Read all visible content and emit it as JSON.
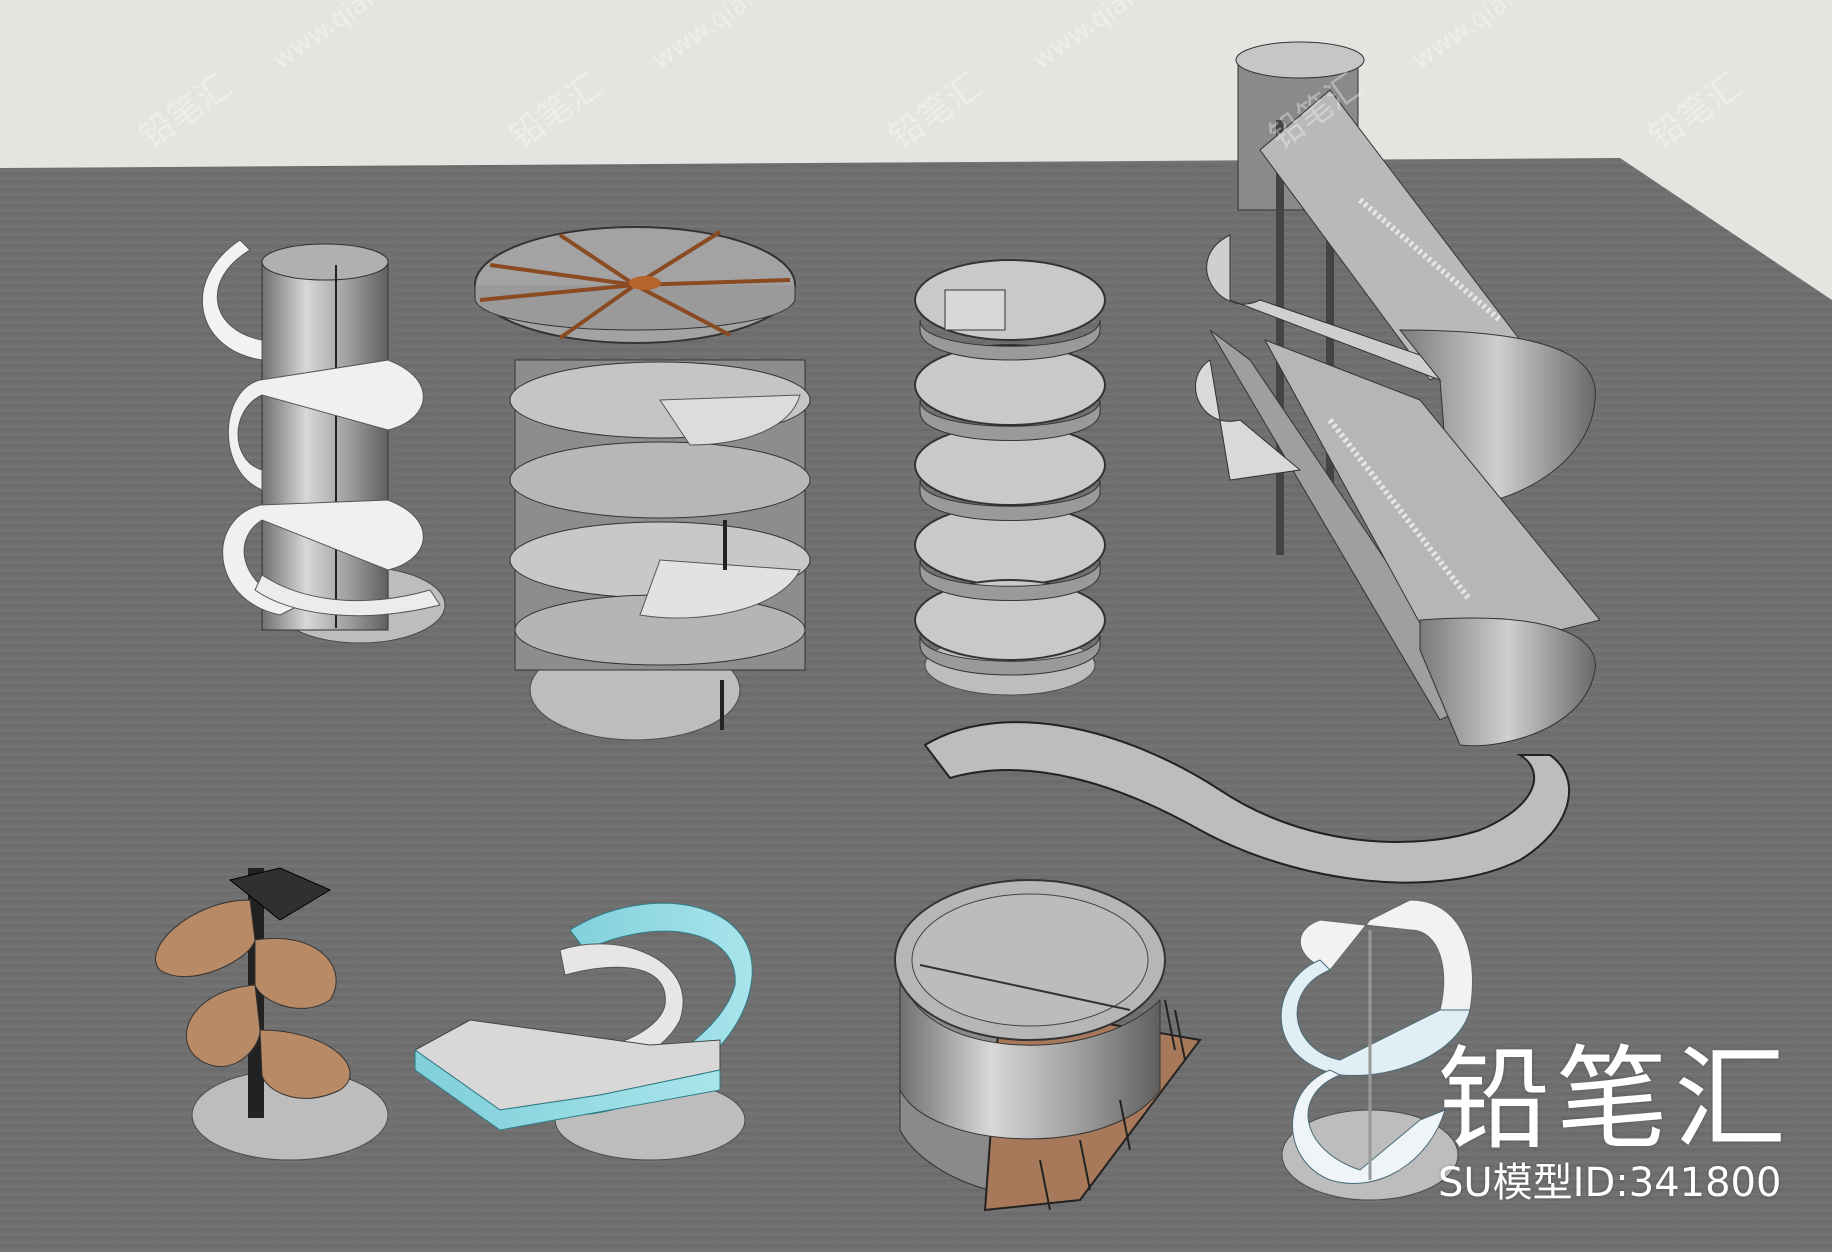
{
  "image": {
    "title": "铅笔汇",
    "model_id_label": "SU模型ID:",
    "model_id": "341800",
    "watermark_mark": "铅笔汇",
    "watermark_url": "www.qianbihui.com"
  },
  "colors": {
    "sky": "#e4e5e1",
    "ground": "#707070",
    "shadow": "#bdbdbd",
    "metal": "#9a9a9a",
    "wood": "#b98a66",
    "glass": "#86d6e0",
    "brand": "#ffffff"
  },
  "objects": [
    "helical-stair-around-core",
    "spiral-stair-with-disc-canopy",
    "ribbon-spiral-stair-tower",
    "stacked-escalator-structure",
    "curved-floor-path",
    "wooden-spiral-stair",
    "glass-spiral-stair",
    "cylindrical-stair-enclosure",
    "white-glass-helix-stair"
  ]
}
